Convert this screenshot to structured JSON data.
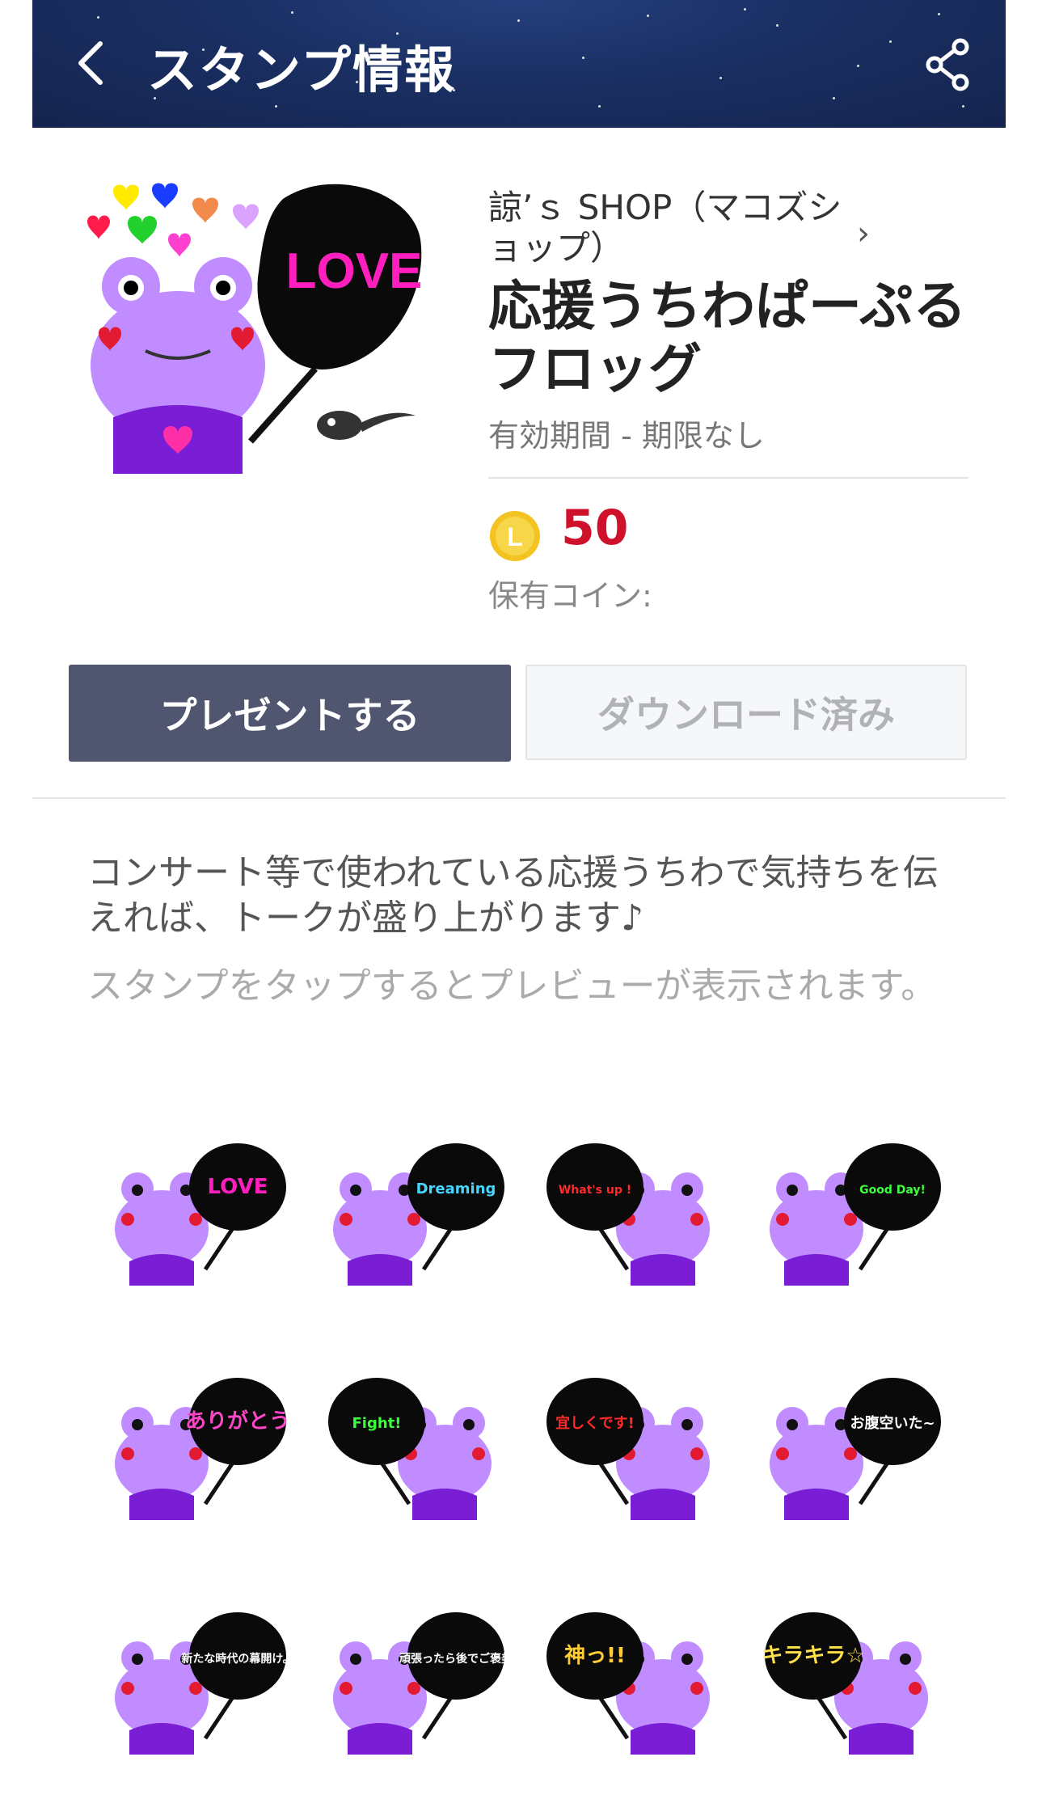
{
  "header": {
    "title": "スタンプ情報",
    "back_icon": "back-chevron-icon",
    "share_icon": "share-icon"
  },
  "product": {
    "creator": "諒’ｓ SHOP（マコズショップ）",
    "title": "応援うちわぱーぷるフロッグ",
    "validity": "有効期間 - 期限なし",
    "price": "50",
    "coin_icon_letter": "L",
    "owned_coins_label": "保有コイン:",
    "main_sticker_text": "LOVE"
  },
  "buttons": {
    "present": "プレゼントする",
    "download": "ダウンロード済み"
  },
  "description": "コンサート等で使われている応援うちわで気持ちを伝えれば、トークが盛り上がります♪",
  "hint": "スタンプをタップするとプレビューが表示されます。",
  "stickers": [
    {
      "text": "LOVE",
      "color": "#ff1fbf"
    },
    {
      "text": "Dreaming",
      "color": "#46d6ff"
    },
    {
      "text": "What's up !",
      "color": "#ff2a2a"
    },
    {
      "text": "Good Day!",
      "color": "#3bff3b"
    },
    {
      "text": "ありがとう",
      "color": "#ff45c8"
    },
    {
      "text": "Fight!",
      "color": "#3bff3b"
    },
    {
      "text": "宜しくです!",
      "color": "#ff2a2a"
    },
    {
      "text": "お腹空いた~",
      "color": "#ffffff"
    },
    {
      "text": "新たな時代の幕開け。",
      "color": "#ffffff"
    },
    {
      "text": "頑張ったら後でご褒美",
      "color": "#ffffff"
    },
    {
      "text": "神っ!!",
      "color": "#ffcc33"
    },
    {
      "text": "キラキラ☆",
      "color": "#ffe04a"
    }
  ],
  "colors": {
    "header_bg": "#1a2f63",
    "present_button_bg": "#50566f",
    "price_color": "#d0112b",
    "frog_body": "#c08cff",
    "coin": "#f3c321"
  }
}
